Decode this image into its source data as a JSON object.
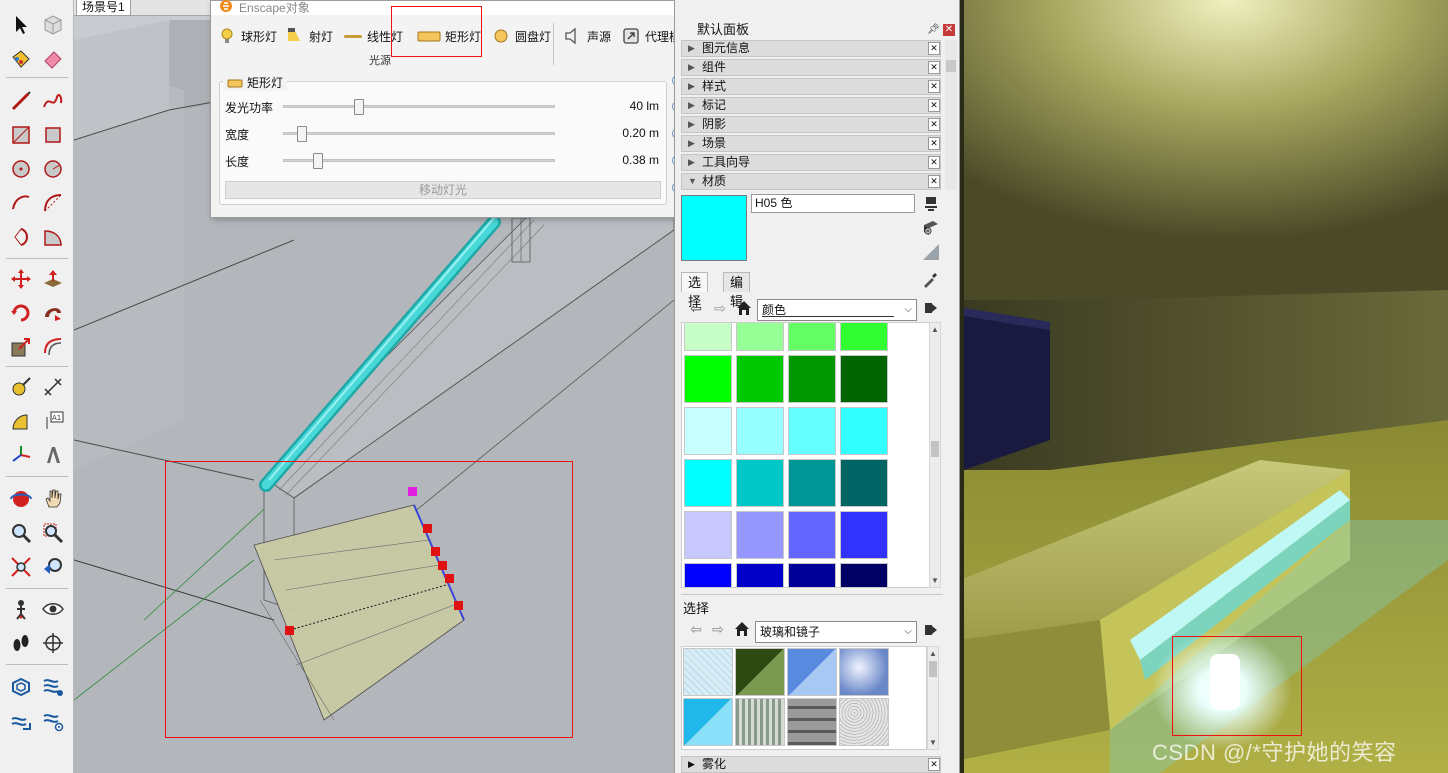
{
  "viewport": {
    "scene_tab": "场景号1"
  },
  "enscape": {
    "title": "Enscape对象",
    "light_types": [
      {
        "label": "球形灯",
        "icon": "bulb-icon"
      },
      {
        "label": "射灯",
        "icon": "spotlight-icon"
      },
      {
        "label": "线性灯",
        "icon": "linear-light-icon"
      },
      {
        "label": "矩形灯",
        "icon": "rectangle-light-icon"
      },
      {
        "label": "圆盘灯",
        "icon": "disk-light-icon"
      },
      {
        "label": "声源",
        "icon": "speaker-icon"
      },
      {
        "label": "代理模型",
        "icon": "proxy-model-icon"
      }
    ],
    "light_source_label": "光源",
    "group_title": "矩形灯",
    "params": [
      {
        "label": "发光功率",
        "value": "40 lm",
        "slider": 0.27
      },
      {
        "label": "宽度",
        "value": "0.20 m",
        "slider": 0.05
      },
      {
        "label": "长度",
        "value": "0.38 m",
        "slider": 0.11
      }
    ],
    "move_light": "移动灯光",
    "help": "?"
  },
  "tray": {
    "title": "默认面板",
    "sections": [
      "图元信息",
      "组件",
      "样式",
      "标记",
      "阴影",
      "场景",
      "工具向导",
      "材质"
    ],
    "material_name": "H05 色",
    "tabs": [
      "选择",
      "编辑"
    ],
    "collection": "颜色",
    "swatch_colors": [
      [
        "#c8ffc8",
        "#96ff96",
        "#64ff64",
        "#32ff32"
      ],
      [
        "#00ff00",
        "#00c800",
        "#009600",
        "#006400"
      ],
      [
        "#c8ffff",
        "#96ffff",
        "#64ffff",
        "#32ffff"
      ],
      [
        "#00ffff",
        "#00c8c8",
        "#009696",
        "#006464"
      ],
      [
        "#c8c8ff",
        "#9696ff",
        "#6464ff",
        "#3232ff"
      ],
      [
        "#0000ff",
        "#0000c8",
        "#000096",
        "#000064"
      ]
    ],
    "secondary_label": "选择",
    "secondary_collection": "玻璃和镜子",
    "fog_section": "雾化"
  },
  "render": {
    "watermark": "CSDN @/*守护她的笑容"
  },
  "colors": {
    "highlight_red": "#e11111",
    "light_cyan": "#33c7c7",
    "render_yellow": "#8a8a2a"
  }
}
